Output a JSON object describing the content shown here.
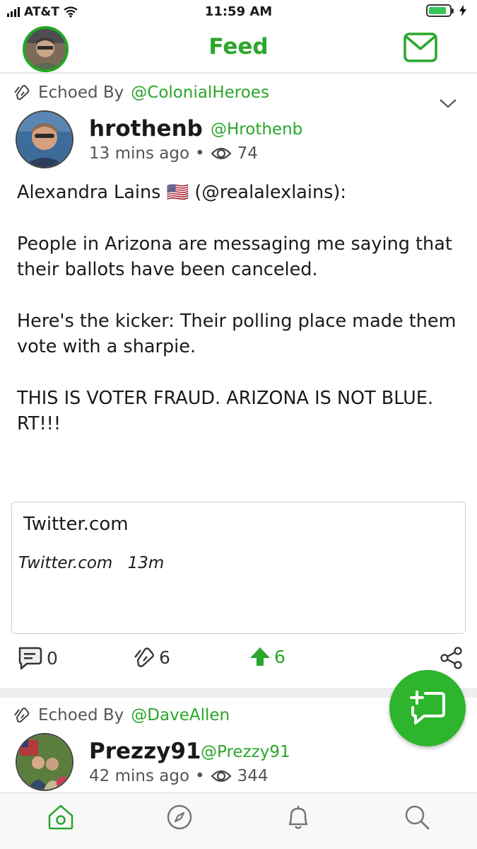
{
  "status_bar": {
    "carrier": "AT&T",
    "time": "11:59 AM",
    "battery_percent": 85
  },
  "header": {
    "title": "Feed",
    "avatar_icon": "user-avatar",
    "messages_icon": "envelope-icon"
  },
  "posts": [
    {
      "echo_label": "Echoed By",
      "echo_handle": "@ColonialHeroes",
      "author_name": "hrothenb",
      "author_handle": "@Hrothenb",
      "time_ago": "13 mins ago",
      "separator": "•",
      "views": "74",
      "body": [
        "Alexandra Lains 🇺🇸 (@realalexlains):",
        "People in Arizona are messaging me saying that their ballots have been canceled.",
        "Here's the kicker: Their polling place made them vote with a sharpie.",
        "THIS IS VOTER FRAUD. ARIZONA IS NOT BLUE.\nRT!!!"
      ],
      "link_card": {
        "title": "Twitter.com",
        "source": "Twitter.com",
        "age": "13m"
      },
      "comments": "0",
      "echoes": "6",
      "upvotes": "6"
    },
    {
      "echo_label": "Echoed By",
      "echo_handle": "@DaveAllen",
      "author_name": "Prezzy91",
      "author_handle": "@Prezzy91",
      "time_ago": "42 mins ago",
      "separator": "•",
      "views": "344"
    }
  ],
  "colors": {
    "brand_green": "#2aa62a",
    "fab_green": "#2db52d"
  },
  "bottom_nav": [
    "home-icon",
    "compass-icon",
    "bell-icon",
    "search-icon"
  ]
}
